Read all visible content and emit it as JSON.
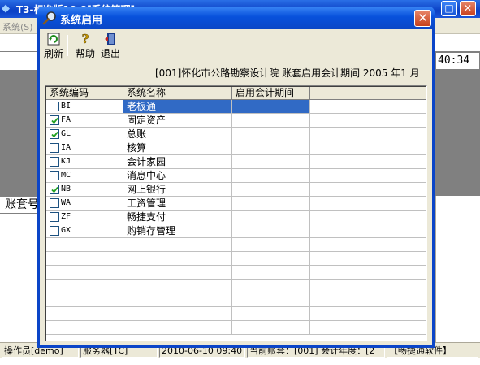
{
  "background_window": {
    "title": "T3-标准版10.8[系统管理]",
    "menu": [
      "系统(S)"
    ],
    "time_display": "40:34",
    "account_label": "账套号",
    "status_bar": [
      "操作员[demo]",
      "服务器[TC]",
      "2010-06-10 09:40",
      "当前账套：[001]  会计年度：[2",
      "【畅捷通软件】"
    ]
  },
  "dialog": {
    "title": "系统启用",
    "toolbar": [
      {
        "label": "刷新",
        "icon": "refresh-icon"
      },
      {
        "label": "帮助",
        "icon": "help-icon"
      },
      {
        "label": "退出",
        "icon": "exit-icon"
      }
    ],
    "period_info": "[001]怀化市公路勘察设计院 账套启用会计期间 2005 年1 月",
    "table": {
      "columns": [
        "系统编码",
        "系统名称",
        "启用会计期间",
        ""
      ],
      "rows": [
        {
          "code": "BI",
          "name": "老板通",
          "period": "",
          "checked": false,
          "selected": true
        },
        {
          "code": "FA",
          "name": "固定资产",
          "period": "",
          "checked": true,
          "selected": false
        },
        {
          "code": "GL",
          "name": "总账",
          "period": "",
          "checked": true,
          "selected": false
        },
        {
          "code": "IA",
          "name": "核算",
          "period": "",
          "checked": false,
          "selected": false
        },
        {
          "code": "KJ",
          "name": "会计家园",
          "period": "",
          "checked": false,
          "selected": false
        },
        {
          "code": "MC",
          "name": "消息中心",
          "period": "",
          "checked": false,
          "selected": false
        },
        {
          "code": "NB",
          "name": "网上银行",
          "period": "",
          "checked": true,
          "selected": false
        },
        {
          "code": "WA",
          "name": "工资管理",
          "period": "",
          "checked": false,
          "selected": false
        },
        {
          "code": "ZF",
          "name": "畅捷支付",
          "period": "",
          "checked": false,
          "selected": false
        },
        {
          "code": "GX",
          "name": "购销存管理",
          "period": "",
          "checked": false,
          "selected": false
        }
      ],
      "empty_rows": 7
    }
  },
  "colors": {
    "title_blue": "#0a47c6",
    "selection": "#316ac5",
    "dialog_face": "#ece9d8",
    "background_gray": "#808080"
  }
}
